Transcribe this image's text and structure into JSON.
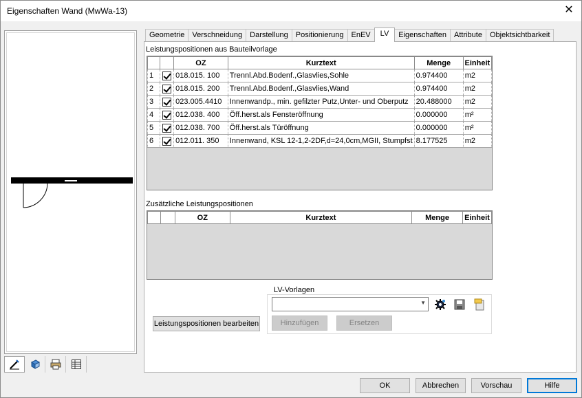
{
  "window": {
    "title": "Eigenschaften Wand (MwWa-13)"
  },
  "tabs": [
    {
      "label": "Geometrie",
      "active": false
    },
    {
      "label": "Verschneidung",
      "active": false
    },
    {
      "label": "Darstellung",
      "active": false
    },
    {
      "label": "Positionierung",
      "active": false
    },
    {
      "label": "EnEV",
      "active": false
    },
    {
      "label": "LV",
      "active": true
    },
    {
      "label": "Eigenschaften",
      "active": false
    },
    {
      "label": "Attribute",
      "active": false
    },
    {
      "label": "Objektsichtbarkeit",
      "active": false
    }
  ],
  "lv": {
    "section1_label": "Leistungspositionen aus Bauteilvorlage",
    "section2_label": "Zusätzliche Leistungspositionen",
    "columns": {
      "oz": "OZ",
      "kurztext": "Kurztext",
      "menge": "Menge",
      "einheit": "Einheit"
    },
    "rows": [
      {
        "nr": "1",
        "checked": true,
        "oz": "018.015. 100",
        "kurztext": "Trennl.Abd.Bodenf.,Glasvlies,Sohle",
        "menge": "0.974400",
        "einheit": "m2"
      },
      {
        "nr": "2",
        "checked": true,
        "oz": "018.015. 200",
        "kurztext": "Trennl.Abd.Bodenf.,Glasvlies,Wand",
        "menge": "0.974400",
        "einheit": "m2"
      },
      {
        "nr": "3",
        "checked": true,
        "oz": "023.005.4410",
        "kurztext": "Innenwandp., min. gefilzter Putz,Unter- und Oberputz",
        "menge": "20.488000",
        "einheit": "m2"
      },
      {
        "nr": "4",
        "checked": true,
        "oz": "012.038. 400",
        "kurztext": "Öff.herst.als Fensteröffnung",
        "menge": "0.000000",
        "einheit": "m²"
      },
      {
        "nr": "5",
        "checked": true,
        "oz": "012.038. 700",
        "kurztext": "Öff.herst.als Türöffnung",
        "menge": "0.000000",
        "einheit": "m²"
      },
      {
        "nr": "6",
        "checked": true,
        "oz": "012.011. 350",
        "kurztext": "Innenwand, KSL 12-1,2-2DF,d=24,0cm,MGII, Stumpfst",
        "menge": "8.177525",
        "einheit": "m2"
      }
    ],
    "edit_button": "Leistungspositionen bearbeiten",
    "vorlagen": {
      "label": "LV-Vorlagen",
      "selected": "",
      "add_button": "Hinzufügen",
      "replace_button": "Ersetzen"
    }
  },
  "footer": {
    "ok": "OK",
    "cancel": "Abbrechen",
    "preview": "Vorschau",
    "help": "Hilfe"
  },
  "colors": {
    "accent": "#0078d7",
    "window_bg": "#f0f0f0",
    "grid_bg": "#d9d9d9"
  }
}
